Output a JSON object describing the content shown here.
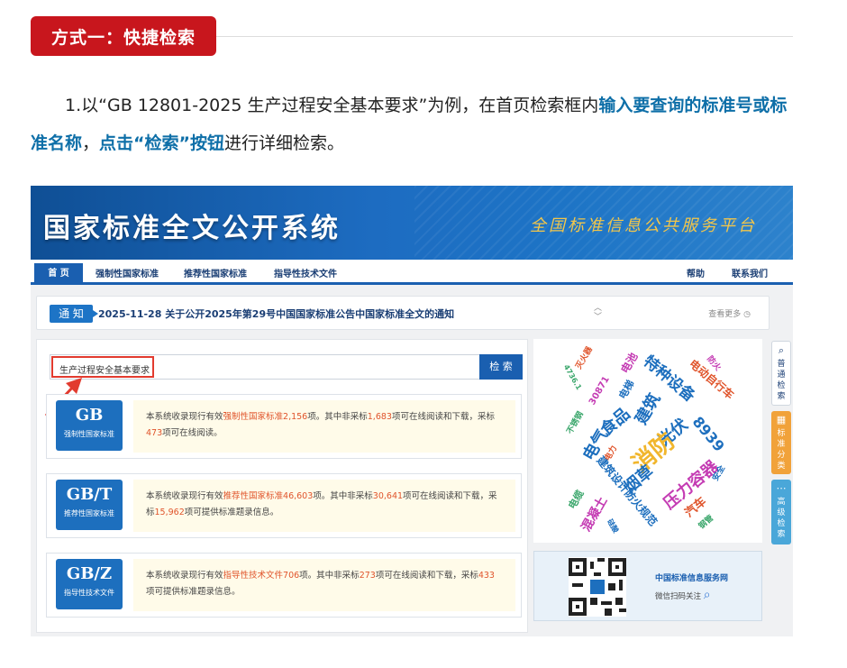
{
  "article": {
    "method_label": "方式一：快捷检索",
    "intro_prefix": "1.以“GB 12801-2025 生产过程安全基本要求”为例，在首页检索框内",
    "intro_hl1": "输入要查询的标准号或标准名称",
    "intro_mid": "，",
    "intro_hl2": "点击“检索”按钮",
    "intro_suffix": "进行详细检索。"
  },
  "site": {
    "title": "国家标准全文公开系统",
    "subtitle": "全国标准信息公共服务平台"
  },
  "nav": {
    "items": [
      "首 页",
      "强制性国家标准",
      "推荐性国家标准",
      "指导性技术文件"
    ],
    "right": [
      "帮助",
      "联系我们"
    ]
  },
  "notice": {
    "tag": "通 知",
    "text": "2025-11-28  关于公开2025年第29号中国国家标准公告中国家标准全文的通知",
    "more": "查看更多"
  },
  "search": {
    "value": "生产过程安全基本要求",
    "button": "检 索"
  },
  "cards": [
    {
      "code": "GB",
      "name": "强制性国家标准",
      "d1": "本系统收录现行有效",
      "link": "强制性国家标准",
      "n1": "2,156",
      "d2": "项。其中非采标",
      "n2": "1,683",
      "d3": "项可在线阅读和下载，采标",
      "n3": "473",
      "d4": "项可在线阅读。"
    },
    {
      "code": "GB/T",
      "name": "推荐性国家标准",
      "d1": "本系统收录现行有效",
      "link": "推荐性国家标准",
      "n1": "46,603",
      "d2": "项。其中非采标",
      "n2": "30,641",
      "d3": "项可在线阅读和下载，采标",
      "n3": "15,962",
      "d4": "项可提供标准题录信息。"
    },
    {
      "code": "GB/Z",
      "name": "指导性技术文件",
      "d1": "本系统收录现行有效",
      "link": "指导性技术文件",
      "n1": "706",
      "d2": "项。其中非采标",
      "n2": "273",
      "d3": "项可在线阅读和下载，采标",
      "n3": "433",
      "d4": "项可提供标准题录信息。"
    }
  ],
  "word_cloud": [
    {
      "t": "灭火器",
      "c": "#e0542b"
    },
    {
      "t": "电池",
      "c": "#c43bb3"
    },
    {
      "t": "特种设备",
      "c": "#1d6fbe"
    },
    {
      "t": "电动自行车",
      "c": "#e0542b"
    },
    {
      "t": "防火",
      "c": "#c43bb3"
    },
    {
      "t": "4736.1",
      "c": "#3aa66b"
    },
    {
      "t": "30871",
      "c": "#c43bb3"
    },
    {
      "t": "电梯",
      "c": "#1d6fbe"
    },
    {
      "t": "建筑",
      "c": "#1d6fbe"
    },
    {
      "t": "食品",
      "c": "#1d6fbe"
    },
    {
      "t": "光伏",
      "c": "#1d6fbe"
    },
    {
      "t": "8939",
      "c": "#1d6fbe"
    },
    {
      "t": "不锈钢",
      "c": "#3aa66b"
    },
    {
      "t": "电气",
      "c": "#1d6fbe"
    },
    {
      "t": "消防",
      "c": "#f1b62c"
    },
    {
      "t": "电力",
      "c": "#e0542b"
    },
    {
      "t": "烟草",
      "c": "#1d6fbe"
    },
    {
      "t": "压力容器",
      "c": "#c43bb3"
    },
    {
      "t": "建筑设计防火规范",
      "c": "#1d6fbe"
    },
    {
      "t": "安全",
      "c": "#1d6fbe"
    },
    {
      "t": "电缆",
      "c": "#3aa66b"
    },
    {
      "t": "混凝土",
      "c": "#c43bb3"
    },
    {
      "t": "汽车",
      "c": "#e0542b"
    },
    {
      "t": "钢管",
      "c": "#3aa66b"
    },
    {
      "t": "硅酸",
      "c": "#1d6fbe"
    }
  ],
  "qr": {
    "title": "中国标准信息服务网",
    "sub": "微信扫码关注"
  },
  "side_tabs": [
    {
      "label": "普通检索",
      "color": "#ffffff"
    },
    {
      "label": "标准分类",
      "color": "#f1a23a"
    },
    {
      "label": "高级检索",
      "color": "#4aa7d9"
    }
  ]
}
